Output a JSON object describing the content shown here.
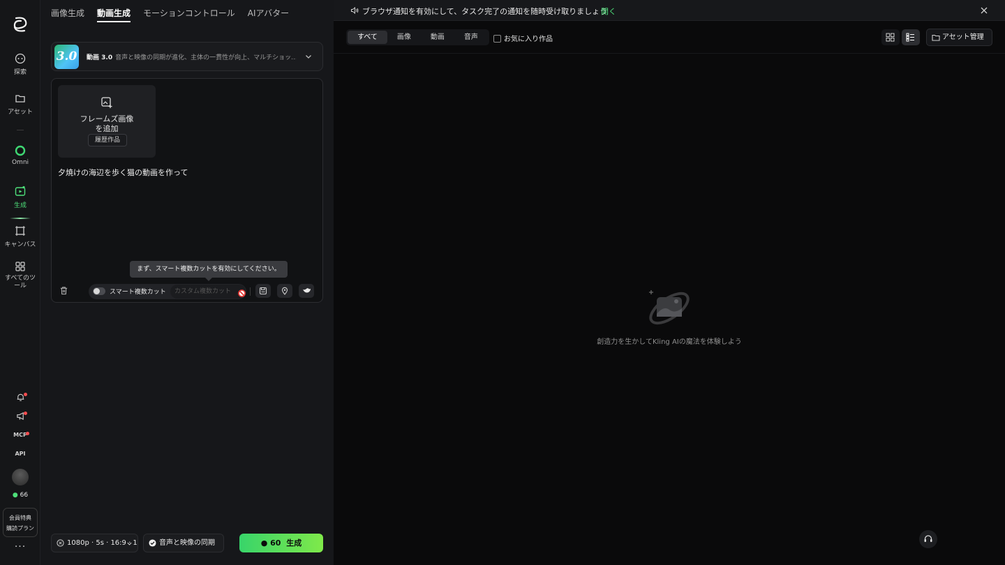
{
  "sidebar": {
    "items": [
      {
        "label": "探索",
        "icon": "explore-icon"
      },
      {
        "label": "アセット",
        "icon": "folder-icon"
      },
      {
        "label": "Omni",
        "icon": "omni-icon"
      },
      {
        "label": "生成",
        "icon": "generate-icon"
      },
      {
        "label": "キャンバス",
        "icon": "canvas-icon"
      },
      {
        "label": "すべてのツール",
        "icon": "grid-icon"
      }
    ],
    "mcp_label": "MCP",
    "api_label": "API",
    "credits": "66",
    "plan_line1": "会員特典",
    "plan_line2": "購読プラン",
    "more": "···"
  },
  "tabs": [
    "画像生成",
    "動画生成",
    "モーションコントロール",
    "AIアバター"
  ],
  "active_tab": 1,
  "model": {
    "badge": "3.0",
    "name": "動画 3.0",
    "description": "音声と映像の同期が進化、主体の一貫性が向上、マルチショッ..."
  },
  "editor": {
    "add_frame_line1": "フレームズ画像",
    "add_frame_line2": "を追加",
    "history_button": "履歴作品",
    "prompt": "夕焼けの海辺を歩く猫の動画を作って",
    "tooltip": "まず、スマート複数カットを有効にしてください。",
    "smart_cut_label": "スマート複数カット",
    "custom_cut_placeholder": "カスタム複数カット"
  },
  "bottom": {
    "settings": "1080p · 5s · 16:9 · 1",
    "sync_label": "音声と映像の同期",
    "generate_cost": "60",
    "generate_label": "生成"
  },
  "notice": {
    "text": "ブラウザ通知を有効にして、タスク完了の通知を随時受け取りましょう",
    "link": "開く"
  },
  "filters": {
    "tabs": [
      "すべて",
      "画像",
      "動画",
      "音声"
    ],
    "active": 0,
    "favorites": "お気に入り作品"
  },
  "asset_button": "アセット管理",
  "empty_state": "創造力を生かしてKling AIの魔法を体験しよう",
  "colors": {
    "accent": "#4ee07a",
    "background": "#0a0a0b",
    "panel": "#16171a"
  }
}
